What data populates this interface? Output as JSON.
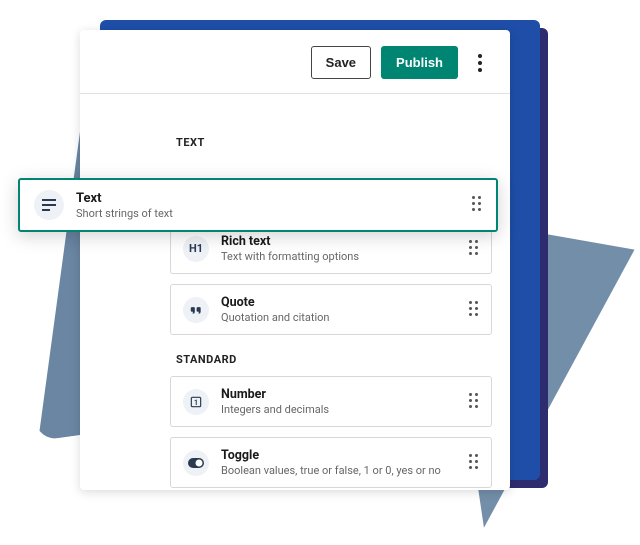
{
  "toolbar": {
    "save_label": "Save",
    "publish_label": "Publish"
  },
  "sections": {
    "text": {
      "label": "TEXT",
      "items": [
        {
          "title": "Text",
          "desc": "Short strings of text",
          "icon": "text"
        },
        {
          "title": "Rich text",
          "desc": "Text with formatting options",
          "icon": "H1"
        },
        {
          "title": "Quote",
          "desc": "Quotation and citation",
          "icon": "quote"
        }
      ]
    },
    "standard": {
      "label": "STANDARD",
      "items": [
        {
          "title": "Number",
          "desc": "Integers and decimals",
          "icon": "1"
        },
        {
          "title": "Toggle",
          "desc": "Boolean values, true or false, 1 or 0, yes or no",
          "icon": "toggle"
        }
      ]
    }
  },
  "colors": {
    "accent": "#008573"
  }
}
